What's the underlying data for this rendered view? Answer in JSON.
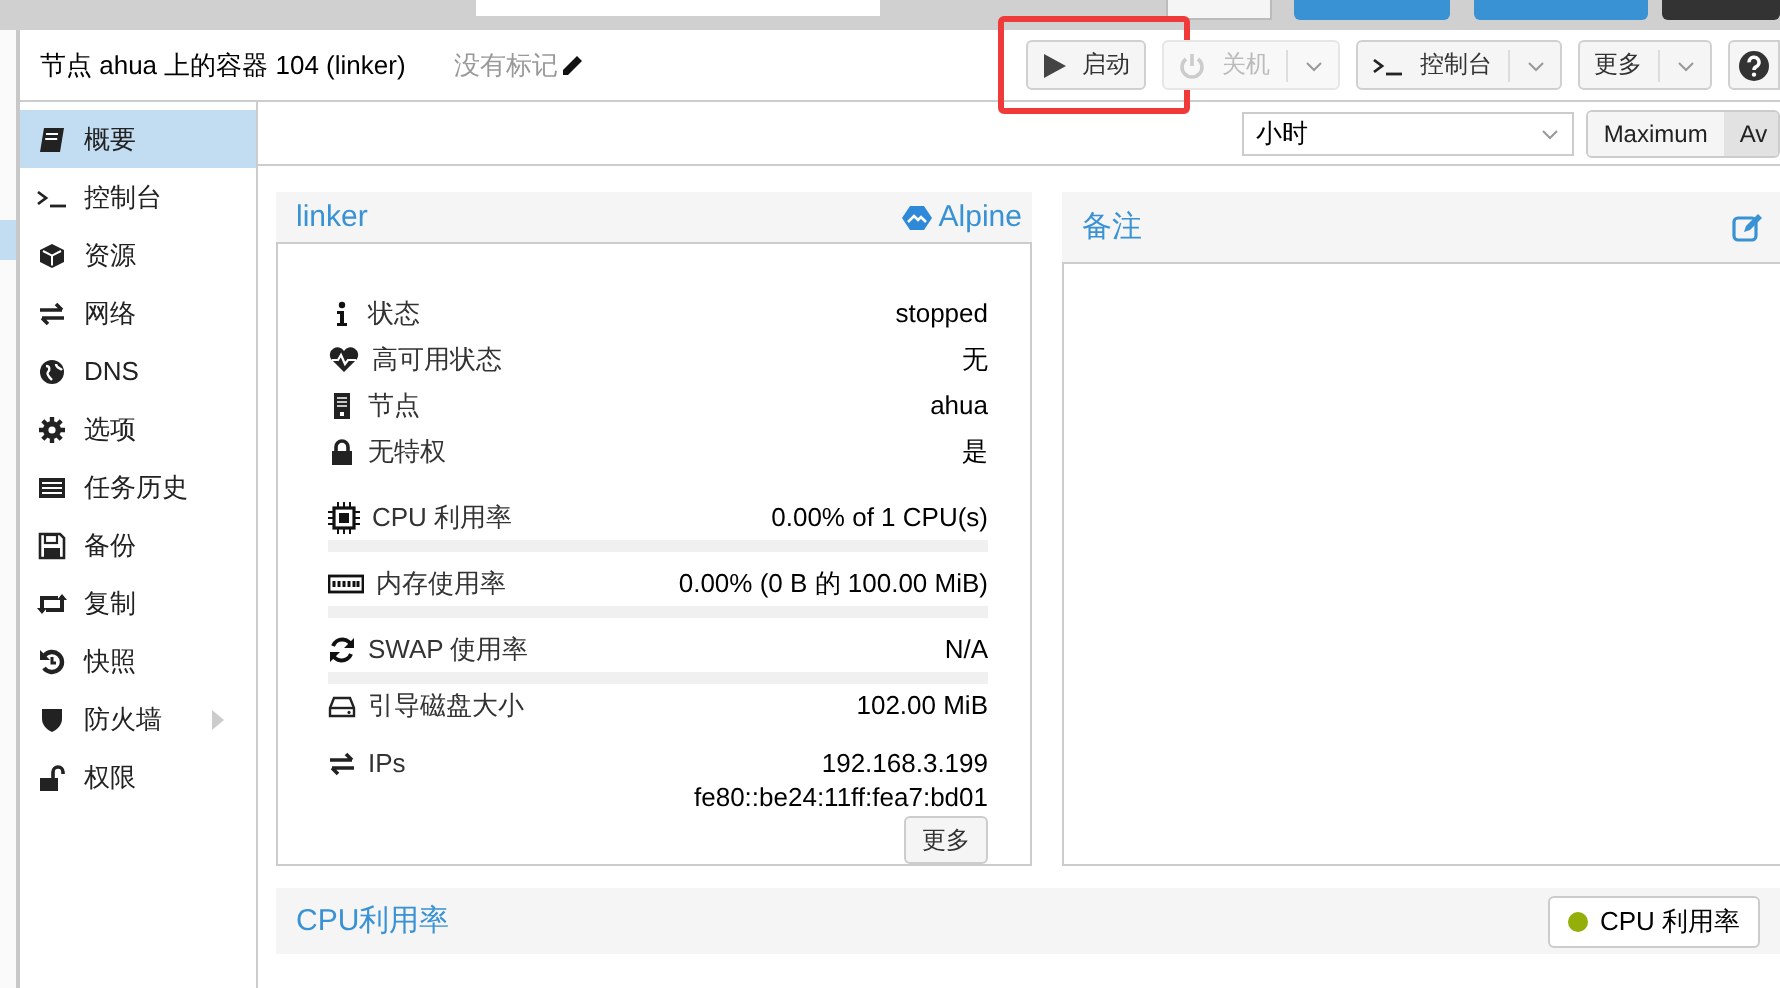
{
  "header": {
    "title": "节点 ahua 上的容器 104 (linker)",
    "tags": "没有标记"
  },
  "toolbar": {
    "buttons": [
      {
        "kind": "play",
        "label": "启动",
        "disabled": false,
        "has_menu": false,
        "highlighted": true
      },
      {
        "kind": "power",
        "label": "关机",
        "disabled": true,
        "has_menu": true,
        "highlighted": false
      },
      {
        "kind": "console",
        "label": "控制台",
        "disabled": false,
        "has_menu": true,
        "highlighted": false
      },
      {
        "kind": "plain",
        "label": "更多",
        "disabled": false,
        "has_menu": true,
        "highlighted": false
      },
      {
        "kind": "help",
        "disabled": false,
        "has_menu": false,
        "highlighted": false
      }
    ]
  },
  "nav": {
    "items": [
      {
        "kind": "book",
        "label": "概要",
        "selected": true,
        "has_submenu": false
      },
      {
        "kind": "console",
        "label": "控制台",
        "selected": false,
        "has_submenu": false
      },
      {
        "kind": "cube",
        "label": "资源",
        "selected": false,
        "has_submenu": false
      },
      {
        "kind": "exchange",
        "label": "网络",
        "selected": false,
        "has_submenu": false
      },
      {
        "kind": "globe",
        "label": "DNS",
        "selected": false,
        "has_submenu": false
      },
      {
        "kind": "gear",
        "label": "选项",
        "selected": false,
        "has_submenu": false
      },
      {
        "kind": "list",
        "label": "任务历史",
        "selected": false,
        "has_submenu": false
      },
      {
        "kind": "floppy",
        "label": "备份",
        "selected": false,
        "has_submenu": false
      },
      {
        "kind": "retweet",
        "label": "复制",
        "selected": false,
        "has_submenu": false
      },
      {
        "kind": "history",
        "label": "快照",
        "selected": false,
        "has_submenu": false
      },
      {
        "kind": "shield",
        "label": "防火墙",
        "selected": false,
        "has_submenu": true
      },
      {
        "kind": "unlock",
        "label": "权限",
        "selected": false,
        "has_submenu": false
      }
    ]
  },
  "timeframe": {
    "value": "小时"
  },
  "aggregation": [
    {
      "label": "Maximum",
      "selected": false
    },
    {
      "label": "Av",
      "selected": true
    }
  ],
  "status_panel": {
    "title": "linker",
    "os": "Alpine",
    "rows": [
      {
        "kind": "info",
        "label": "状态",
        "value": "stopped"
      },
      {
        "kind": "info",
        "label": "高可用状态",
        "value": "无"
      },
      {
        "kind": "info",
        "label": "节点",
        "value": "ahua"
      },
      {
        "kind": "info",
        "label": "无特权",
        "value": "是"
      },
      {
        "kind": "usage",
        "label": "CPU 利用率",
        "value": "0.00% of 1 CPU(s)",
        "level": 0
      },
      {
        "kind": "usage",
        "label": "内存使用率",
        "value": "0.00% (0 B 的 100.00 MiB)",
        "level": 0
      },
      {
        "kind": "usage",
        "label": "SWAP 使用率",
        "value": "N/A",
        "level": 0
      },
      {
        "kind": "info",
        "label": "引导磁盘大小",
        "value": "102.00 MiB"
      }
    ],
    "ips": {
      "label": "IPs",
      "values": [
        "192.168.3.199",
        "fe80::be24:11ff:fea7:bd01"
      ]
    },
    "more_button": "更多"
  },
  "notes_panel": {
    "title": "备注"
  },
  "chart_panel": {
    "title": "CPU利用率",
    "legend": [
      {
        "label": "CPU 利用率",
        "color": "#94ae0a"
      }
    ]
  }
}
